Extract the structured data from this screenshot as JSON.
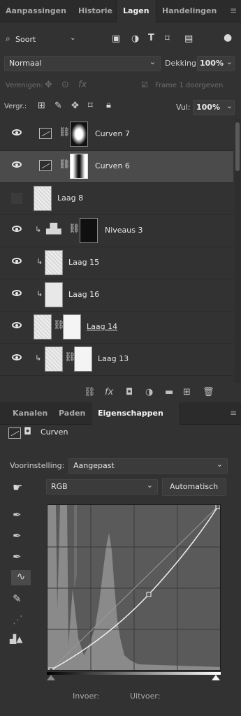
{
  "top_tabs": [
    "Aanpassingen",
    "Historie",
    "Lagen",
    "Handelingen"
  ],
  "filter": {
    "label": "Soort"
  },
  "blend_mode": "Normaal",
  "opacity": {
    "label": "Dekking:",
    "value": "100%"
  },
  "unify": {
    "label": "Verenigen:",
    "frame_label": "Frame 1 doorgeven"
  },
  "lock": {
    "label": "Vergr.:",
    "fill_label": "Vul:",
    "fill_value": "100%"
  },
  "layers": [
    {
      "name": "Curven 7",
      "visible": true,
      "kind": "adjustment",
      "selected": false,
      "clipped": false
    },
    {
      "name": "Curven 6",
      "visible": true,
      "kind": "adjustment",
      "selected": true,
      "clipped": false
    },
    {
      "name": "Laag 8",
      "visible": false,
      "kind": "pixel",
      "selected": false,
      "clipped": false
    },
    {
      "name": "Niveaus 3",
      "visible": true,
      "kind": "adjustment",
      "selected": false,
      "clipped": true
    },
    {
      "name": "Laag 15",
      "visible": true,
      "kind": "pixel",
      "selected": false,
      "clipped": true
    },
    {
      "name": "Laag 16",
      "visible": true,
      "kind": "pixel",
      "selected": false,
      "clipped": true
    },
    {
      "name": "Laag 14",
      "visible": true,
      "kind": "pixel",
      "selected": false,
      "clipped": false
    },
    {
      "name": "Laag 13",
      "visible": true,
      "kind": "pixel",
      "selected": false,
      "clipped": true
    }
  ],
  "bottom_tabs": [
    "Kanalen",
    "Paden",
    "Eigenschappen"
  ],
  "properties": {
    "title": "Curven",
    "preset_label": "Voorinstelling:",
    "preset_value": "Aangepast",
    "channel": "RGB",
    "auto_button": "Automatisch",
    "input_label": "Invoer:",
    "output_label": "Uitvoer:"
  },
  "colors": {
    "panel": "#323232",
    "tabbar": "#2b2b2b",
    "selected_row": "#4b4b4b",
    "graph_bg": "#5a5a5a"
  }
}
